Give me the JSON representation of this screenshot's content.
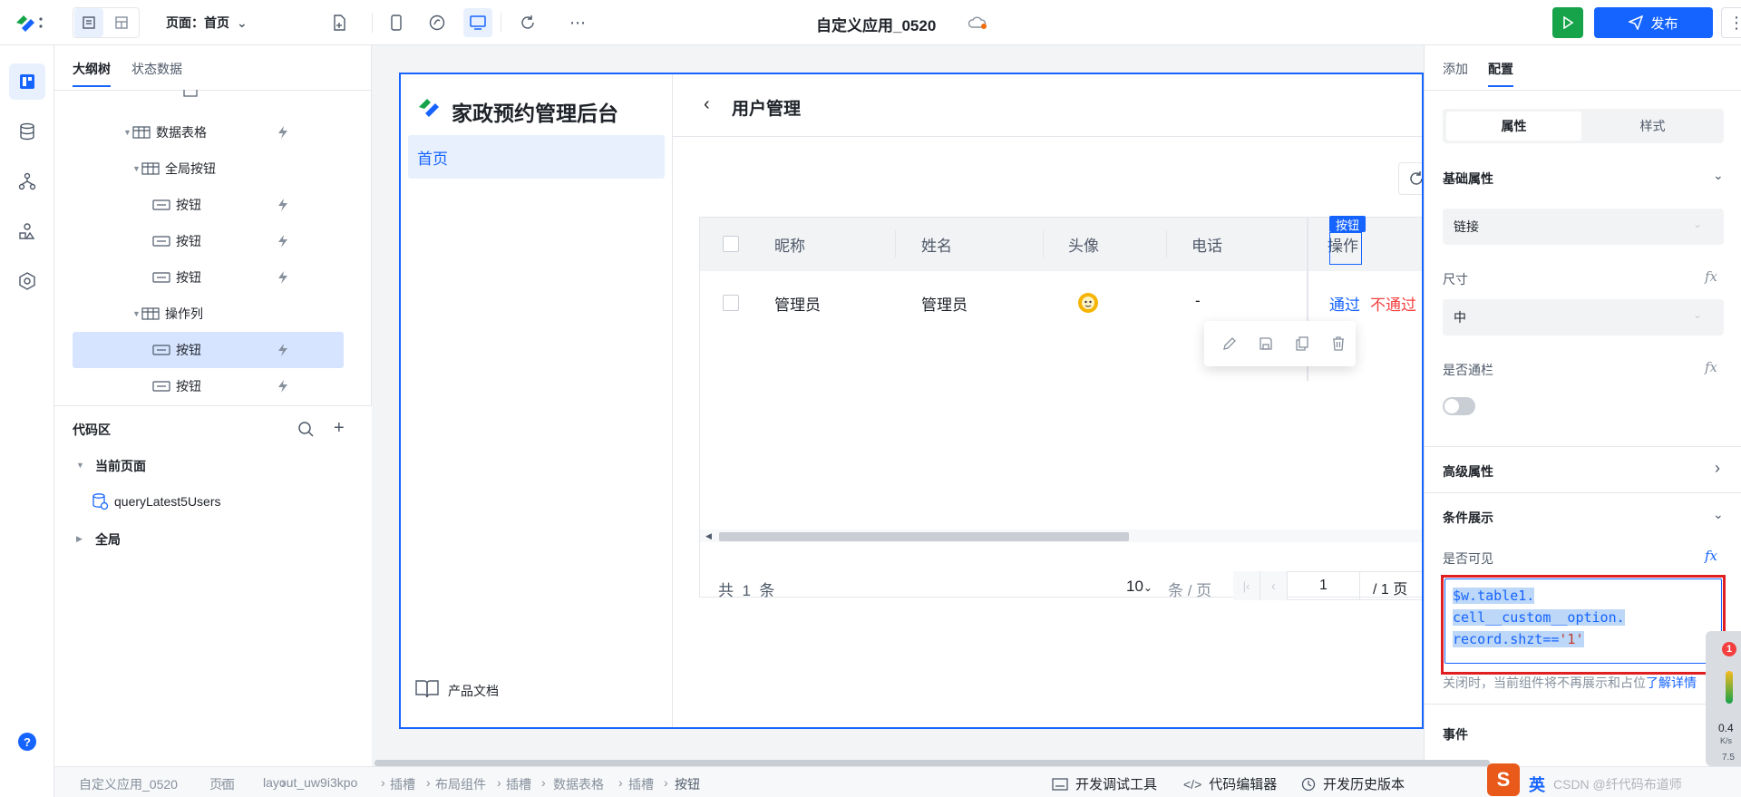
{
  "topbar": {
    "page_label": "页面：首页",
    "app_title": "自定义应用_0520",
    "publish_label": "发布"
  },
  "outline": {
    "tabs": [
      "大纲树",
      "状态数据"
    ],
    "tree": [
      {
        "label": "数据表格"
      },
      {
        "label": "全局按钮"
      },
      {
        "label": "按钮"
      },
      {
        "label": "按钮"
      },
      {
        "label": "按钮"
      },
      {
        "label": "操作列"
      },
      {
        "label": "按钮"
      },
      {
        "label": "按钮"
      }
    ]
  },
  "code_area": {
    "title": "代码区",
    "current_page": "当前页面",
    "query": "queryLatest5Users",
    "global": "全局"
  },
  "canvas": {
    "app_name": "家政预约管理后台",
    "home_item": "首页",
    "product_docs": "产品文档",
    "page_title": "用户管理",
    "columns": [
      "昵称",
      "姓名",
      "头像",
      "电话",
      "操作"
    ],
    "row": {
      "nickname": "管理员",
      "name": "管理员",
      "phone": "-",
      "pass": "通过",
      "reject": "不通过"
    },
    "tag": "按钮",
    "pagination": {
      "total_prefix": "共",
      "total": "1",
      "total_suffix": "条",
      "page_size": "10",
      "page_size_unit": "条 / 页",
      "current": "1",
      "page_count": "/ 1 页"
    }
  },
  "rpanel": {
    "tabs": [
      "添加",
      "配置"
    ],
    "seg": [
      "属性",
      "样式"
    ],
    "basic_props": "基础属性",
    "type_value": "链接",
    "size_label": "尺寸",
    "size_value": "中",
    "block_label": "是否通栏",
    "advanced": "高级属性",
    "cond_display": "条件展示",
    "visible_label": "是否可见",
    "expr_line1": "$w.table1.",
    "expr_line2": "cell__custom__option.",
    "expr_line3_prefix": "record.shzt==",
    "expr_line3_str": "'1'",
    "hint": "关闭时，当前组件将不再展示和占位",
    "hint_link": "了解详情",
    "events": "事件",
    "badge": "1",
    "side_text": "0.4",
    "side_unit": "K/s",
    "side_text2": "7.5"
  },
  "statusbar": {
    "crumbs": [
      "自定义应用_0520",
      "页面",
      "layout_uw9i3kpo",
      "插槽",
      "布局组件",
      "插槽",
      "数据表格",
      "插槽",
      "按钮"
    ],
    "tools": [
      "开发调试工具",
      "代码编辑器",
      "开发历史版本"
    ],
    "ime": "英",
    "watermark": "CSDN @纤代码布道师"
  },
  "colors": {
    "primary": "#1664ff",
    "run_green": "#16a34a",
    "danger": "#f53f3f",
    "highlight_red": "#e02020"
  }
}
